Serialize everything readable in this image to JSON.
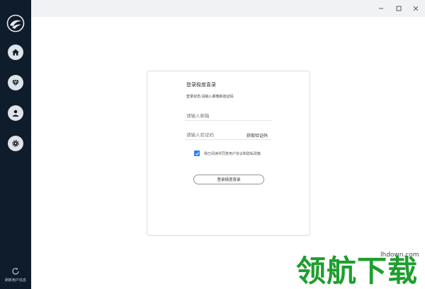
{
  "sidebar": {
    "nav": [
      {
        "icon": "home-icon"
      },
      {
        "icon": "diamond-icon"
      },
      {
        "icon": "user-icon"
      },
      {
        "icon": "gear-icon"
      }
    ],
    "user_info": "刷新用户信息"
  },
  "login": {
    "title": "登录极度喜录",
    "status": "登录状态:请输入邮箱和验证码",
    "email_placeholder": "请输入邮箱",
    "code_placeholder": "请输入验证码",
    "get_code": "获取验证码",
    "agree_text": "我已阅读并同意用户协议和隐私政策",
    "agree_checked": true,
    "submit_label": "登录极度喜录"
  },
  "watermark": {
    "url": "lhdown.com",
    "text": "领航下载"
  },
  "colors": {
    "sidebar_bg": "#0f1c2b",
    "accent": "#2d7ff9",
    "watermark": "#1e9e2e"
  }
}
